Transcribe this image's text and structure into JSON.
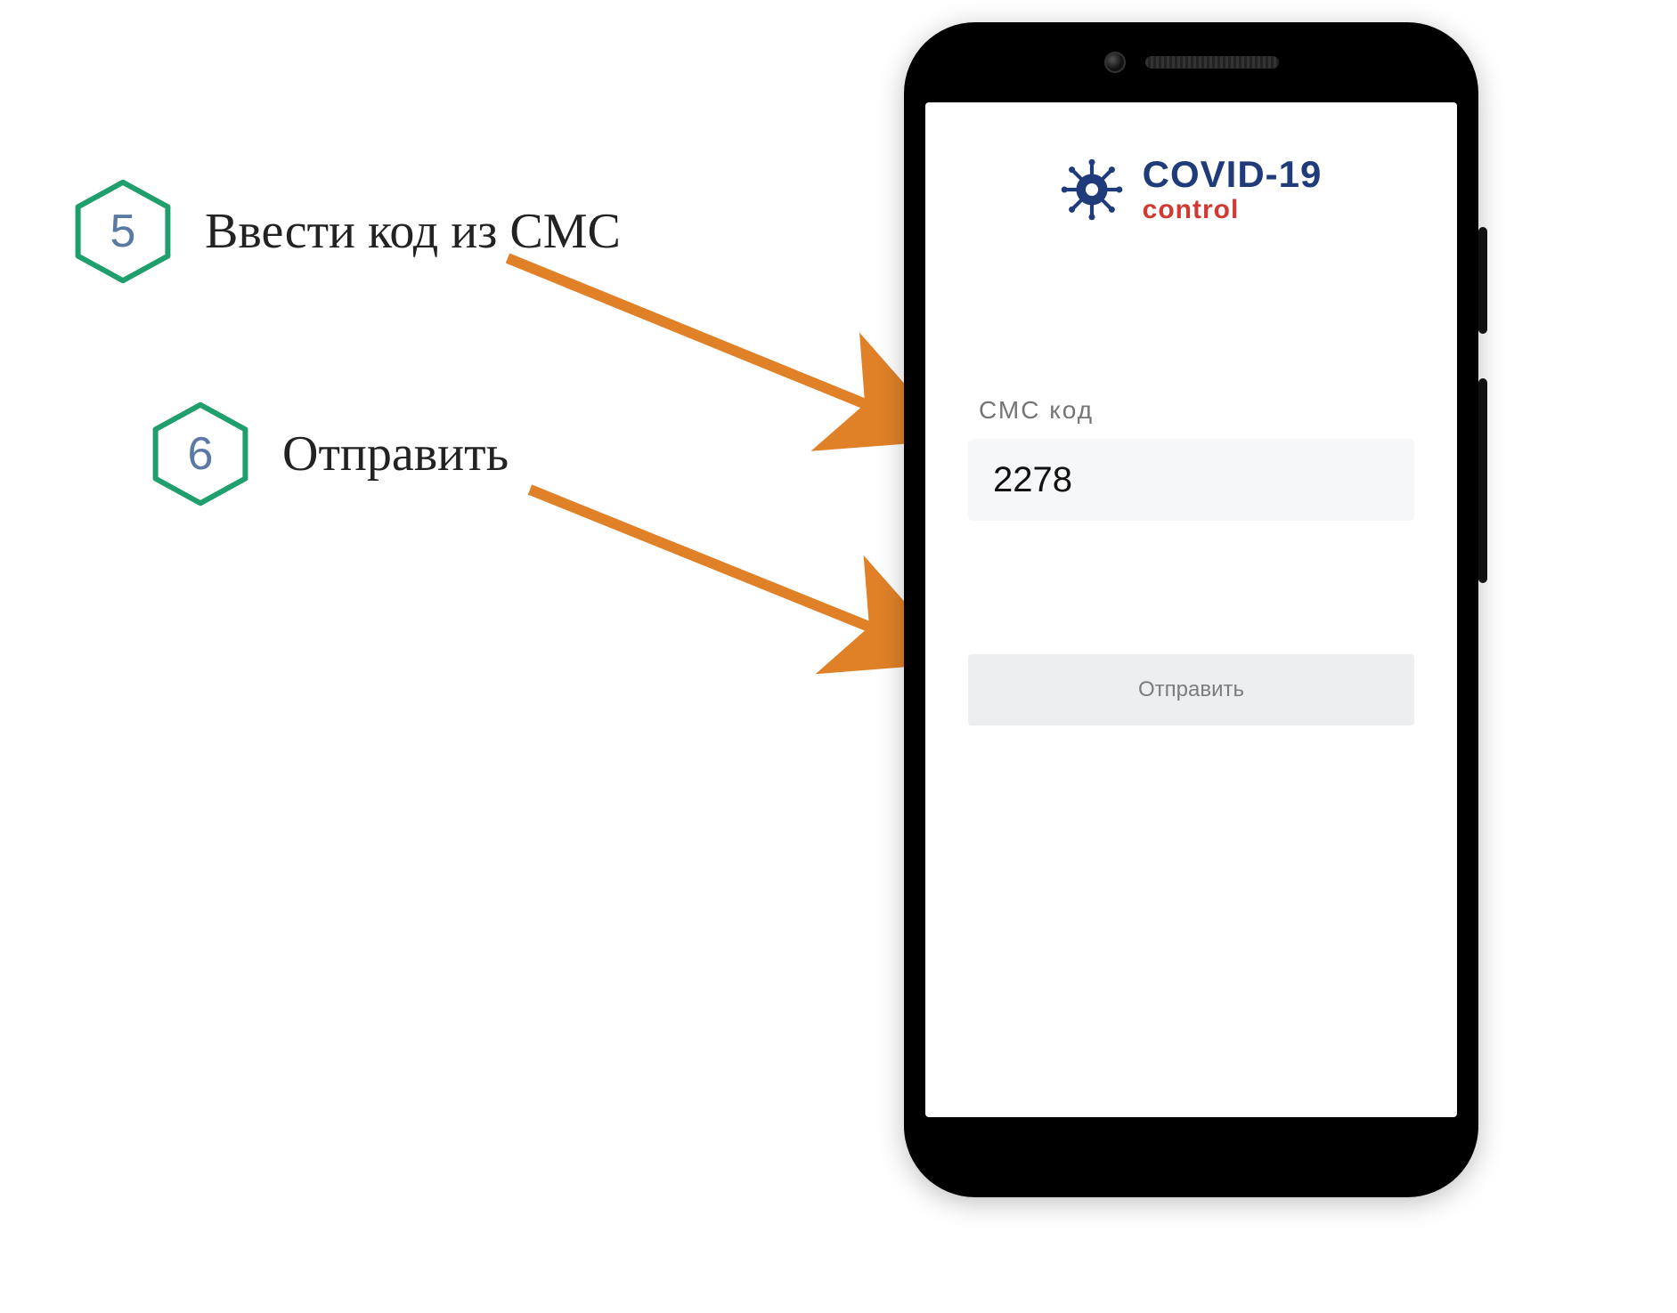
{
  "steps": [
    {
      "number": "5",
      "text": "Ввести код из СМС"
    },
    {
      "number": "6",
      "text": "Отправить"
    }
  ],
  "app": {
    "logo_line1": "COVID-19",
    "logo_line2": "control",
    "sms_label": "СМС  код",
    "sms_value": "2278",
    "submit_label": "Отправить"
  },
  "colors": {
    "hex_stroke": "#1f9f6b",
    "hex_number": "#5b7aa3",
    "logo_primary": "#1f3b7a",
    "logo_accent": "#d13a32",
    "arrow": "#e08128"
  }
}
